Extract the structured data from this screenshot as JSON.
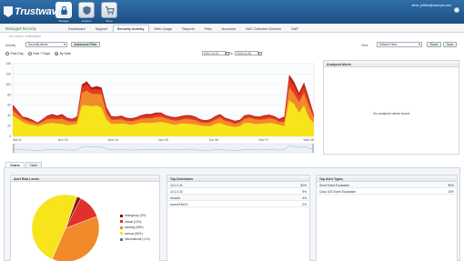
{
  "header": {
    "logo_text": "Trustwave",
    "app_icons": [
      {
        "name": "lock-icon",
        "label": "Manage",
        "active": true
      },
      {
        "name": "shield-icon",
        "label": "Analyze",
        "active": false
      },
      {
        "name": "cart-icon",
        "label": "Shop",
        "active": false
      }
    ],
    "user_email": "steve_jeffries@example.com"
  },
  "nav": {
    "app_title": "Managed Security",
    "tabs": [
      "Dashboard",
      "Support",
      "Security Activity",
      "Web Usage",
      "Reports",
      "Files",
      "Accounts",
      "NAC Detected Devices",
      "NAP"
    ],
    "active_tab": "Security Activity"
  },
  "toolbar": {
    "subline": "No custom notifications",
    "activity_label": "Activity",
    "activity_value": "Security Alerts",
    "advanced_label": "Advanced Filter",
    "view_label": "View",
    "view_value": "Default View",
    "reset_label": "Reset",
    "save_label": "Save"
  },
  "range": {
    "options": [
      "Past Day",
      "Past 7 Days",
      "By Date"
    ],
    "selected": "By Date",
    "from": "2013-10-31",
    "to_label": "To",
    "to": "2013-11-05"
  },
  "chart_data": {
    "type": "area",
    "title": "",
    "ylim": [
      0,
      140
    ],
    "yticks": [
      0,
      20,
      40,
      60,
      80,
      100,
      120,
      140
    ],
    "x_tick_labels": [
      "Sat 01",
      "Nov 03",
      "Mon 04",
      "Nov 05",
      "Tue 06",
      "Nov 07",
      "Wed 08"
    ],
    "stacked": true,
    "colors": [
      "#f7e41a",
      "#f08a2a",
      "#e23b24",
      "#b7201c"
    ],
    "series": [
      {
        "values": [
          40,
          34,
          28,
          24,
          22,
          20,
          23,
          25,
          26,
          25,
          24,
          22,
          22,
          24,
          60,
          60,
          58,
          60,
          55,
          32,
          24,
          24,
          25,
          24,
          22,
          24,
          26,
          26,
          26,
          27,
          28,
          26,
          24,
          22,
          25,
          25,
          24,
          23,
          21,
          20,
          20,
          24,
          26,
          22,
          20,
          18,
          20,
          26,
          26,
          24,
          24,
          25,
          26,
          25,
          22,
          20,
          70,
          62,
          46,
          60,
          36,
          26
        ]
      },
      {
        "values": [
          10,
          8,
          6,
          6,
          5,
          4,
          5,
          8,
          8,
          8,
          10,
          8,
          6,
          6,
          24,
          28,
          24,
          22,
          26,
          12,
          8,
          8,
          8,
          6,
          7,
          7,
          8,
          9,
          9,
          10,
          10,
          9,
          8,
          8,
          7,
          9,
          9,
          8,
          6,
          6,
          7,
          8,
          10,
          8,
          8,
          6,
          7,
          8,
          10,
          9,
          8,
          8,
          9,
          8,
          6,
          8,
          24,
          20,
          20,
          24,
          22,
          10
        ]
      },
      {
        "values": [
          7,
          6,
          3,
          4,
          3,
          2,
          3,
          5,
          6,
          4,
          6,
          4,
          4,
          6,
          10,
          12,
          8,
          9,
          8,
          8,
          5,
          4,
          5,
          4,
          4,
          4,
          5,
          5,
          5,
          6,
          6,
          4,
          4,
          5,
          5,
          5,
          6,
          5,
          4,
          3,
          4,
          5,
          5,
          4,
          3,
          4,
          3,
          5,
          4,
          4,
          4,
          6,
          5,
          4,
          4,
          6,
          17,
          15,
          12,
          12,
          10,
          4
        ]
      },
      {
        "values": [
          4,
          2,
          1,
          2,
          2,
          1,
          2,
          2,
          3,
          3,
          3,
          2,
          2,
          2,
          6,
          6,
          4,
          6,
          5,
          4,
          2,
          2,
          2,
          2,
          2,
          2,
          2,
          3,
          3,
          3,
          2,
          2,
          2,
          2,
          2,
          2,
          2,
          2,
          2,
          2,
          2,
          2,
          2,
          2,
          2,
          2,
          2,
          2,
          2,
          2,
          2,
          2,
          2,
          2,
          2,
          4,
          8,
          8,
          6,
          8,
          6,
          2
        ]
      }
    ]
  },
  "alerts_panel": {
    "title": "Analyzed Alerts",
    "empty_text": "No analyzed alerts found"
  },
  "bottom_tabs": {
    "items": [
      "Charts",
      "Table"
    ],
    "active": "Charts"
  },
  "risk_panel": {
    "title": "Alert Risk Levels",
    "chart_data": {
      "type": "pie",
      "labels": [
        "emergency",
        "critical",
        "warning",
        "serious",
        "informational"
      ],
      "values": [
        2,
        12,
        38,
        50,
        0.1
      ],
      "colors": [
        "#7d1914",
        "#e0322a",
        "#f08a2a",
        "#f7e41a",
        "#2f80c8"
      ]
    },
    "legend": [
      "emergency (2%)",
      "critical (12%)",
      "warning (38%)",
      "serious (50%)",
      "informational (<1%)"
    ]
  },
  "detections_panel": {
    "title": "Top Detections",
    "rows": [
      {
        "name": "10.1.0.41",
        "value": "82%"
      },
      {
        "name": "10.1.0.33",
        "value": "9%"
      },
      {
        "name": "records",
        "value": "4%"
      },
      {
        "name": "sourceFileXX",
        "value": "2%"
      }
    ]
  },
  "types_panel": {
    "title": "Top Alert Types",
    "rows": [
      {
        "name": "Short Event Escalation",
        "value": "90%"
      },
      {
        "name": "Cisco IDS Event Escalation",
        "value": "10%"
      }
    ]
  }
}
